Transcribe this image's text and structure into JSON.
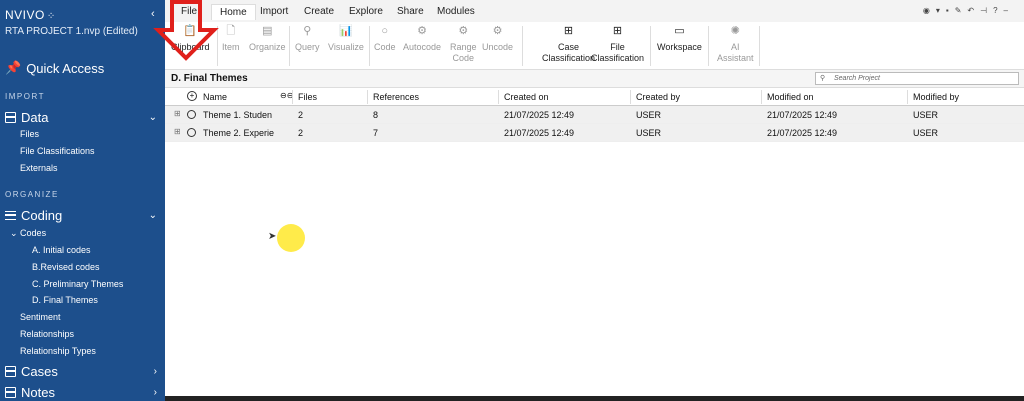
{
  "app": {
    "logo": "NVIVO",
    "project_name": "RTA PROJECT 1.nvp (Edited)"
  },
  "sidebar": {
    "quick_access": "Quick Access",
    "import_label": "IMPORT",
    "data_label": "Data",
    "data_items": [
      "Files",
      "File Classifications",
      "Externals"
    ],
    "organize_label": "ORGANIZE",
    "coding_label": "Coding",
    "codes_label": "Codes",
    "code_items": [
      "A. Initial codes",
      "B.Revised codes",
      "C. Preliminary Themes",
      "D. Final Themes"
    ],
    "other_items": [
      "Sentiment",
      "Relationships",
      "Relationship Types"
    ],
    "cases_label": "Cases",
    "notes_label": "Notes"
  },
  "ribbon": {
    "tabs": [
      "File",
      "Home",
      "Import",
      "Create",
      "Explore",
      "Share",
      "Modules"
    ],
    "active_tab": "Home",
    "buttons": {
      "clipboard": "Clipboard",
      "item": "Item",
      "organize": "Organize",
      "query": "Query",
      "visualize": "Visualize",
      "code": "Code",
      "autocode": "Autocode",
      "range_code_1": "Range",
      "range_code_2": "Code",
      "uncode": "Uncode",
      "case_class_1": "Case",
      "case_class_2": "Classification",
      "file_class_1": "File",
      "file_class_2": "Classification",
      "workspace": "Workspace",
      "ai_1": "AI",
      "ai_2": "Assistant"
    }
  },
  "content": {
    "folder_title": "D. Final Themes",
    "search_placeholder": "Search Project"
  },
  "table": {
    "columns": [
      "Name",
      "Files",
      "References",
      "Created on",
      "Created by",
      "Modified on",
      "Modified by"
    ],
    "rows": [
      {
        "name": "Theme 1. Studen",
        "files": "2",
        "references": "8",
        "created_on": "21/07/2025 12:49",
        "created_by": "USER",
        "modified_on": "21/07/2025 12:49",
        "modified_by": "USER"
      },
      {
        "name": "Theme 2. Experie",
        "files": "2",
        "references": "7",
        "created_on": "21/07/2025 12:49",
        "created_by": "USER",
        "modified_on": "21/07/2025 12:49",
        "modified_by": "USER"
      }
    ]
  },
  "colors": {
    "sidebar_bg": "#1d4f8c",
    "annotation_arrow": "#e0201b",
    "highlight": "#ffe82a"
  }
}
